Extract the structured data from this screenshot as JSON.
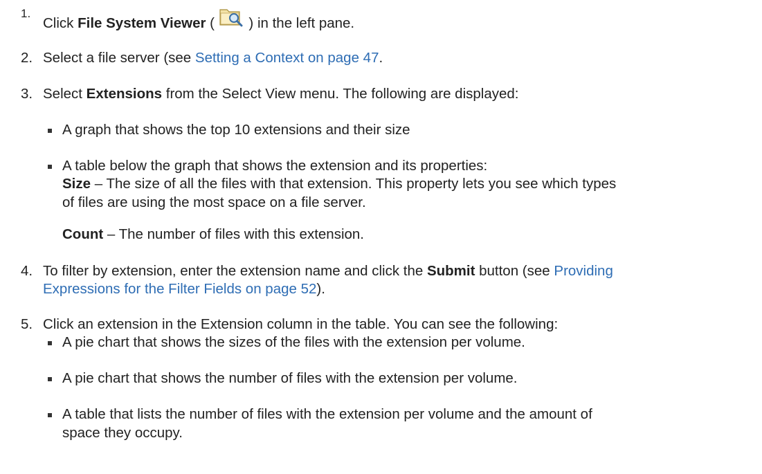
{
  "steps": {
    "s1": {
      "num": "1.",
      "pre": "Click ",
      "bold": "File System Viewer",
      "open": " (",
      "post": ") in the left pane.",
      "icon": "folder-magnifier-icon"
    },
    "s2": {
      "num": "2.",
      "pre": "Select a file server (see ",
      "link": "Setting a Context on page 47",
      "post": "."
    },
    "s3": {
      "num": "3.",
      "pre": "Select ",
      "bold": "Extensions",
      "post": " from the Select View menu. The following are displayed:",
      "bullets": {
        "b1": "A graph that shows the top 10 extensions and their size",
        "b2": "A table below the graph that shows the extension and its properties:",
        "size_label": "Size",
        "size_line1": " – The size of all the files with that extension. This property lets you see which types",
        "size_line2": "of files are using the most space on a file server.",
        "count_label": "Count",
        "count_text": " – The number of files with this extension."
      }
    },
    "s4": {
      "num": "4.",
      "pre": "To filter by extension, enter the extension name and click the ",
      "bold": "Submit",
      "mid": " button (see ",
      "link1": "Providing",
      "link2": "Expressions for the Filter Fields on page 52",
      "post": ")."
    },
    "s5": {
      "num": "5.",
      "text": "Click an extension in the Extension column in the table. You can see the following:",
      "bullets": {
        "b1": "A pie chart that shows the sizes of the files with the extension per volume.",
        "b2": "A pie chart that shows the number of files with the extension per volume.",
        "b3_line1": "A table that lists the number of files with the extension per volume and the amount of",
        "b3_line2": "space they occupy."
      }
    }
  }
}
